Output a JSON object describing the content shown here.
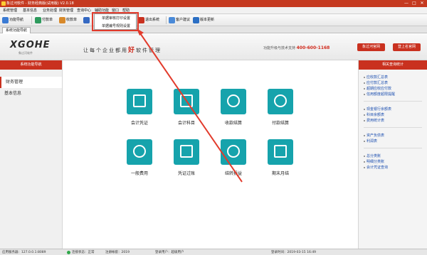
{
  "window": {
    "title": "象过河软件 - 财务经典版(试用版) V2.0.18",
    "minimize": "—",
    "maximize": "□",
    "close": "✕"
  },
  "menubar": {
    "items": [
      "系统管理",
      "基本信息",
      "业务处理",
      "财务管理",
      "查询中心",
      "辅助功能",
      "窗口",
      "帮助"
    ]
  },
  "toolbar": {
    "buttons": [
      "功能导航",
      "付款单",
      "收款单",
      "退出系统",
      "客户建议",
      "版本更新"
    ]
  },
  "dropdown": {
    "items": [
      "单据审核打印设置",
      "单据编号规则设置"
    ]
  },
  "tabstrip": {
    "tabs": [
      "系统功能导航"
    ]
  },
  "header": {
    "logo": "XGOHE",
    "logo_sub": "象过河软件",
    "slogan_pre": "让每个企业都用",
    "slogan_emph": "好",
    "slogan_post": "软件管理",
    "hotline_label": "功能升级与技术支持",
    "hotline_number": "400-600-1168",
    "btn_official": "象过河官网",
    "btn_store": "登上名官网"
  },
  "sidebar_left": {
    "title": "系统功能导航",
    "items": [
      "财务管理",
      "基本信息"
    ]
  },
  "functions": [
    {
      "name": "会计凭证"
    },
    {
      "name": "会计科目"
    },
    {
      "name": "收款结算"
    },
    {
      "name": "付款结算"
    },
    {
      "name": "一般费用"
    },
    {
      "name": "凭证过账"
    },
    {
      "name": "结转损益"
    },
    {
      "name": "期末月结"
    }
  ],
  "sidebar_right": {
    "title": "相关查询统计",
    "groups": [
      [
        "应收款汇总表",
        "应付款汇总表",
        "超期应收应付款",
        "信用额度超限提醒"
      ],
      [
        "现金银行余额表",
        "科目余额表",
        "费用统计表"
      ],
      [
        "资产负债表",
        "利润表"
      ],
      [
        "总分类账",
        "明细分类账",
        "会计凭证查询"
      ]
    ]
  },
  "statusbar": {
    "server": "应用服务器：127.0.0.1:8089",
    "conn": "连接状态：正常",
    "account": "注册帐套：2019",
    "user": "登录用户：超级用户",
    "time": "登录时间：2019-03-15 16:49"
  },
  "colors": {
    "brand_red": "#c9311f",
    "tile_teal": "#16a3ac",
    "annotation_red": "#e23b2c"
  }
}
